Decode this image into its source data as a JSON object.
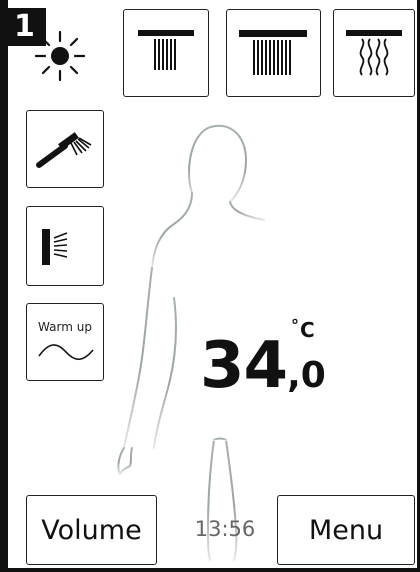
{
  "zone": {
    "number": "1"
  },
  "controls": {
    "top_row": [
      {
        "icon": "sun-icon"
      },
      {
        "icon": "narrow-rain-shower-icon"
      },
      {
        "icon": "wide-rain-shower-icon"
      },
      {
        "icon": "waterfall-shower-icon"
      }
    ],
    "side_column": [
      {
        "icon": "hand-shower-icon"
      },
      {
        "icon": "side-jet-icon"
      },
      {
        "icon": "wave-icon",
        "label": "Warm up"
      }
    ]
  },
  "temperature": {
    "integer": "34",
    "decimal": ",0",
    "degree": "°",
    "unit": "C"
  },
  "footer": {
    "volume_label": "Volume",
    "time": "13:56",
    "menu_label": "Menu"
  },
  "colors": {
    "silhouette_dark": "#9aa59d",
    "silhouette_light": "#dfe5e1",
    "frame": "#111111"
  }
}
